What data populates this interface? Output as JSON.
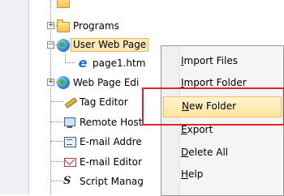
{
  "tree": {
    "items": [
      {
        "label": "Programs",
        "icon": "folder-icon"
      },
      {
        "label": "User Web Page",
        "icon": "globe-icon"
      },
      {
        "label": "page1.htm",
        "icon": "ie-page-icon"
      },
      {
        "label": "Web Page Edi",
        "icon": "web-editor-icon"
      },
      {
        "label": "Tag Editor",
        "icon": "pencil-icon"
      },
      {
        "label": "Remote Host",
        "icon": "monitor-icon"
      },
      {
        "label": "E-mail Addre",
        "icon": "address-book-icon"
      },
      {
        "label": "E-mail Editor",
        "icon": "mail-icon"
      },
      {
        "label": "Script Manag",
        "icon": "script-icon"
      }
    ],
    "expanders": {
      "collapsed": "+",
      "expanded": "−"
    }
  },
  "context_menu": {
    "items": [
      {
        "label_prefix": "",
        "label_underline": "I",
        "label_rest": "mport Files"
      },
      {
        "label_prefix": "",
        "label_underline": "I",
        "label_rest": "mport Folder"
      },
      {
        "label_prefix": "",
        "label_underline": "N",
        "label_rest": "ew Folder"
      },
      {
        "label_prefix": "",
        "label_underline": "E",
        "label_rest": "xport"
      },
      {
        "label_prefix": "",
        "label_underline": "D",
        "label_rest": "elete All"
      },
      {
        "label_prefix": "",
        "label_underline": "H",
        "label_rest": "elp"
      }
    ],
    "highlighted_index": 2
  },
  "colors": {
    "highlight_fill": "#fde59d",
    "annotation_red": "#e0262b",
    "selection_fill": "#fde7b3"
  }
}
